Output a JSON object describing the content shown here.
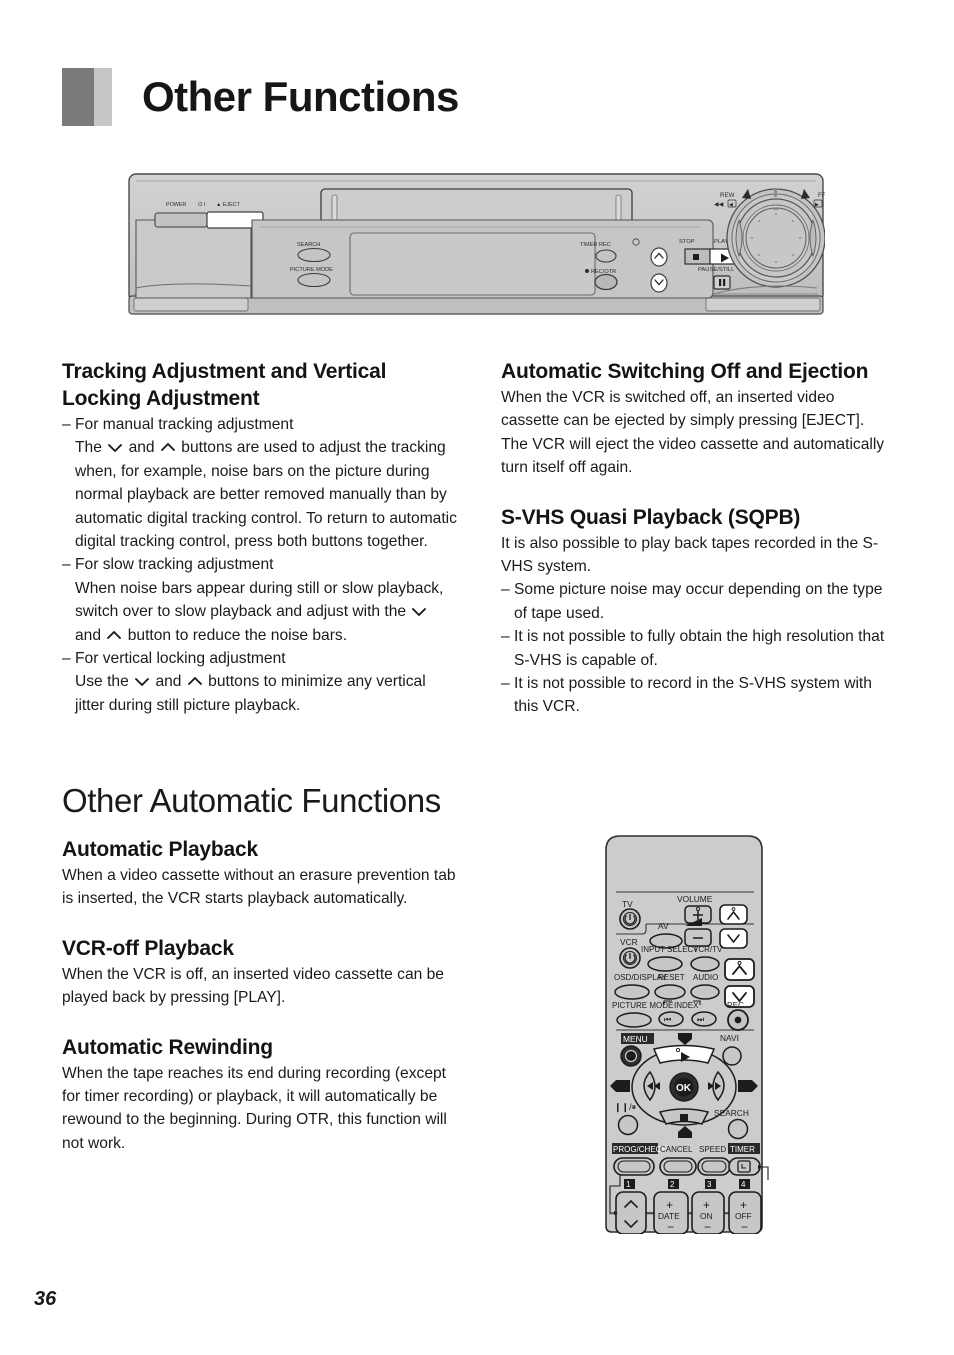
{
  "page": {
    "title": "Other Functions",
    "number": "36"
  },
  "vcr_diagram": {
    "labels": {
      "power": "POWER",
      "eject": "EJECT",
      "search": "SEARCH",
      "picture_mode": "PICTURE MODE",
      "timer_rec": "TIMER REC",
      "rec_otr": "REC/OTR",
      "stop": "STOP",
      "play": "PLAY",
      "pause_still": "PAUSE/STILL",
      "rew": "REW",
      "ff": "FF"
    }
  },
  "left_column": {
    "heading": "Tracking Adjustment and Vertical Locking Adjustment",
    "items": [
      {
        "title": "For manual tracking adjustment",
        "body_before": "The",
        "body_mid": "and",
        "body_after": "buttons are used to adjust the tracking when, for example, noise bars on the picture during normal playback are better removed manually than by automatic digital tracking control. To return to automatic digital tracking control, press both buttons together."
      },
      {
        "title": "For slow tracking adjustment",
        "body_before": "When noise bars appear during still or slow playback, switch over to slow playback and adjust with the",
        "body_mid": "and",
        "body_after": "button to reduce the noise bars."
      },
      {
        "title": "For vertical locking adjustment",
        "body_before": "Use the",
        "body_mid": "and",
        "body_after": "buttons to minimize any vertical jitter during still picture playback."
      }
    ]
  },
  "right_column": {
    "section1": {
      "heading": "Automatic Switching Off and Ejection",
      "body": "When the VCR is switched off, an inserted video cassette can be ejected by simply pressing [EJECT]. The VCR will eject the video cassette and automatically turn itself off again."
    },
    "section2": {
      "heading": "S-VHS Quasi Playback (SQPB)",
      "body": "It is also possible to play back tapes recorded in the S-VHS system.",
      "bullets": [
        "Some picture noise may occur depending on the type of tape used.",
        "It is not possible to fully obtain the high resolution that S-VHS is capable of.",
        "It is not possible to record in the S-VHS system with this VCR."
      ]
    }
  },
  "lower_section": {
    "heading": "Other Automatic Functions",
    "subsections": [
      {
        "heading": "Automatic Playback",
        "body": "When a video cassette without an erasure prevention tab is inserted, the VCR starts playback automatically."
      },
      {
        "heading": "VCR-off Playback",
        "body": "When the VCR is off, an inserted video cassette can be played back by pressing [PLAY]."
      },
      {
        "heading": "Automatic Rewinding",
        "body": "When the tape reaches its end during recording (except for timer recording) or playback, it will automatically be rewound to the beginning. During OTR, this function will not work."
      }
    ]
  },
  "remote_diagram": {
    "labels": {
      "tv": "TV",
      "volume": "VOLUME",
      "av": "AV",
      "vcr": "VCR",
      "input_select": "INPUT SELECT",
      "vcr_tv": "VCR/TV",
      "osd_display": "OSD/DISPLAY",
      "reset": "RESET",
      "audio": "AUDIO",
      "picture_mode": "PICTURE MODE",
      "index": "INDEX",
      "rec": "REC",
      "menu": "MENU",
      "navi": "NAVI",
      "ok": "OK",
      "search": "SEARCH",
      "prog_check": "PROG/CHECK",
      "cancel": "CANCEL",
      "speed": "SPEED",
      "timer": "TIMER",
      "num1": "1",
      "num2": "2",
      "num3": "3",
      "num4": "4",
      "date": "DATE",
      "on": "ON",
      "off": "OFF",
      "plus": "+",
      "minus": "−"
    }
  },
  "colors": {
    "title_block_dark": "#7a7a7a",
    "title_block_light": "#c6c6c6",
    "device_body": "#c8c8c8",
    "remote_body": "#cccccc"
  }
}
